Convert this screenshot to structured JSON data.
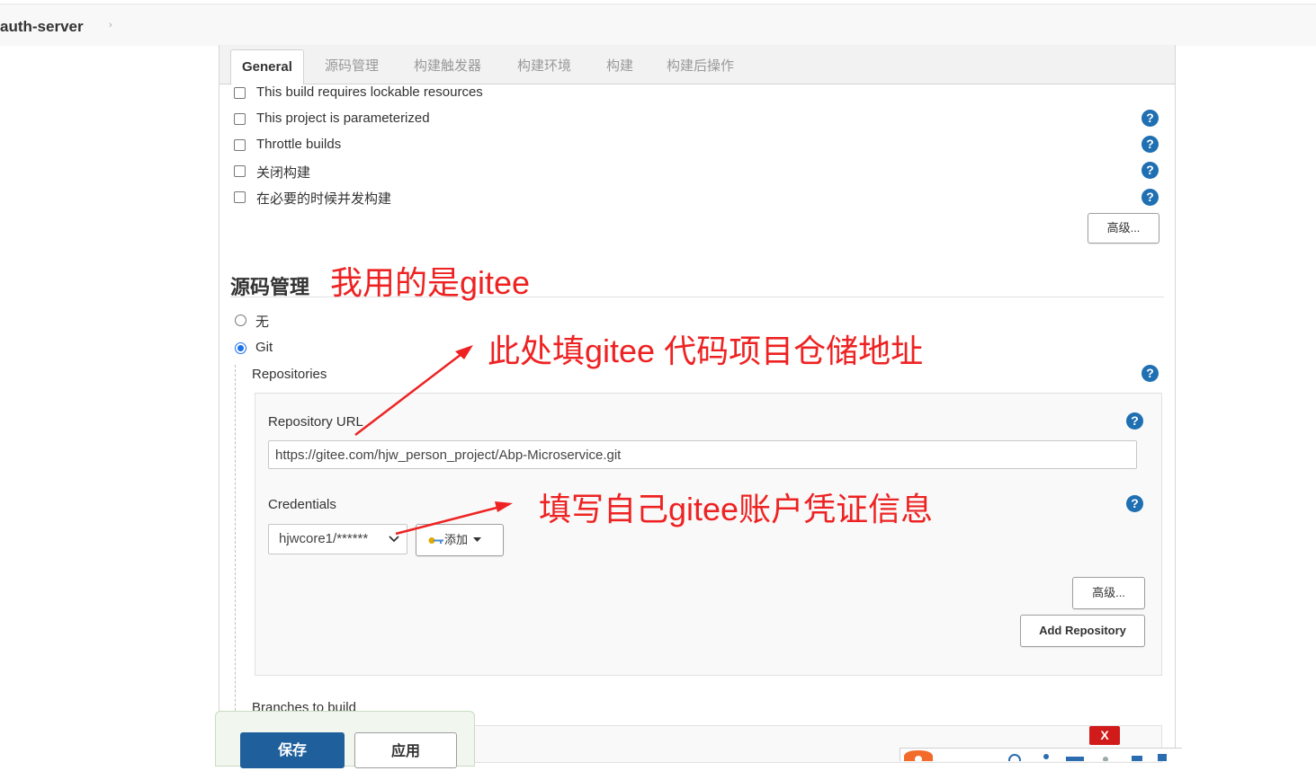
{
  "breadcrumb": {
    "project": "auth-server",
    "separator": "›"
  },
  "tabs": [
    "General",
    "源码管理",
    "构建触发器",
    "构建环境",
    "构建",
    "构建后操作"
  ],
  "general": {
    "options": [
      "This build requires lockable resources",
      "This project is parameterized",
      "Throttle builds",
      "关闭构建",
      "在必要的时候并发构建"
    ],
    "advanced_button": "高级..."
  },
  "scm": {
    "title": "源码管理",
    "options": [
      {
        "label": "无",
        "checked": false
      },
      {
        "label": "Git",
        "checked": true
      }
    ],
    "repositories_label": "Repositories",
    "repository_url_label": "Repository URL",
    "repository_url_value": "https://gitee.com/hjw_person_project/Abp-Microservice.git",
    "credentials_label": "Credentials",
    "credentials_value": "hjwcore1/******",
    "add_button": "添加",
    "advanced_button": "高级...",
    "add_repository_button": "Add Repository",
    "branches_label": "Branches to build"
  },
  "help_glyph": "?",
  "annotations": {
    "scm_note": "我用的是gitee",
    "url_note": "此处填gitee 代码项目仓储地址",
    "cred_note": "填写自己gitee账户凭证信息",
    "annotation_color": "#ee2222"
  },
  "footer": {
    "save_button": "保存",
    "apply_button": "应用"
  },
  "overlay": {
    "close_label": "X"
  },
  "colors": {
    "primary": "#1e5f9c",
    "help": "#1f6fb3",
    "radio": "#1a73e8"
  }
}
